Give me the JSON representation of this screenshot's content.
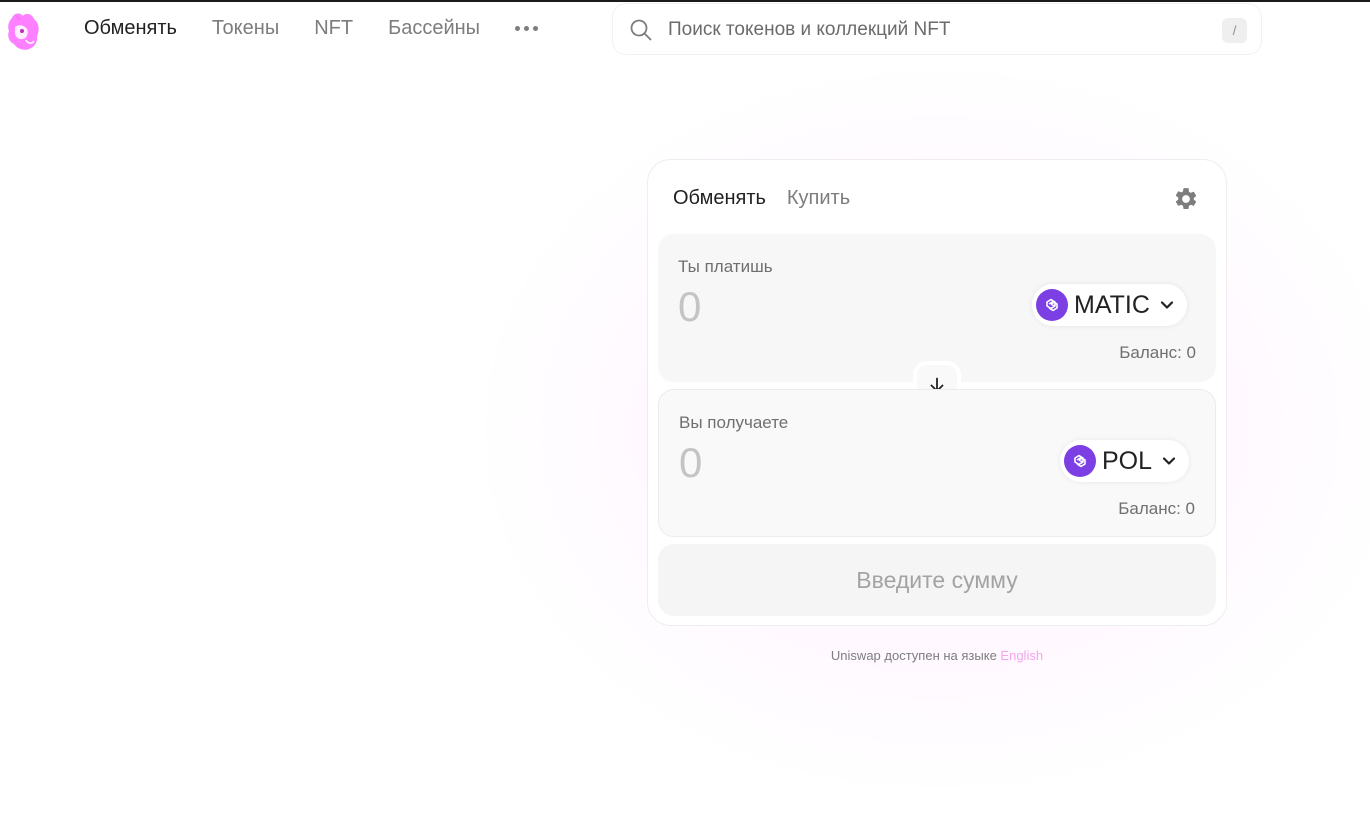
{
  "header": {
    "logo": "uniswap-unicorn-logo",
    "nav": [
      "Обменять",
      "Токены",
      "NFT",
      "Бассейны"
    ],
    "more": "more-dots-icon",
    "search_placeholder": "Поиск токенов и коллекций NFT",
    "search_shortcut": "/"
  },
  "swap": {
    "tabs": [
      "Обменять",
      "Купить"
    ],
    "active_tab": "Обменять",
    "settings_icon": "gear-icon",
    "pay": {
      "label": "Ты платишь",
      "amount_placeholder": "0",
      "token": "MATIC",
      "balance": "Баланс: 0"
    },
    "receive": {
      "label": "Вы получаете",
      "amount_placeholder": "0",
      "token": "POL",
      "balance": "Баланс: 0"
    },
    "switch_icon": "arrow-down-icon",
    "cta": "Введите сумму"
  },
  "footer": {
    "note": "Uniswap доступен на языке",
    "link": "English"
  },
  "colors": {
    "brand_pink": "#fc72ff",
    "polygon_purple": "#7b3fe4",
    "link_pink": "#f1a5ec"
  }
}
